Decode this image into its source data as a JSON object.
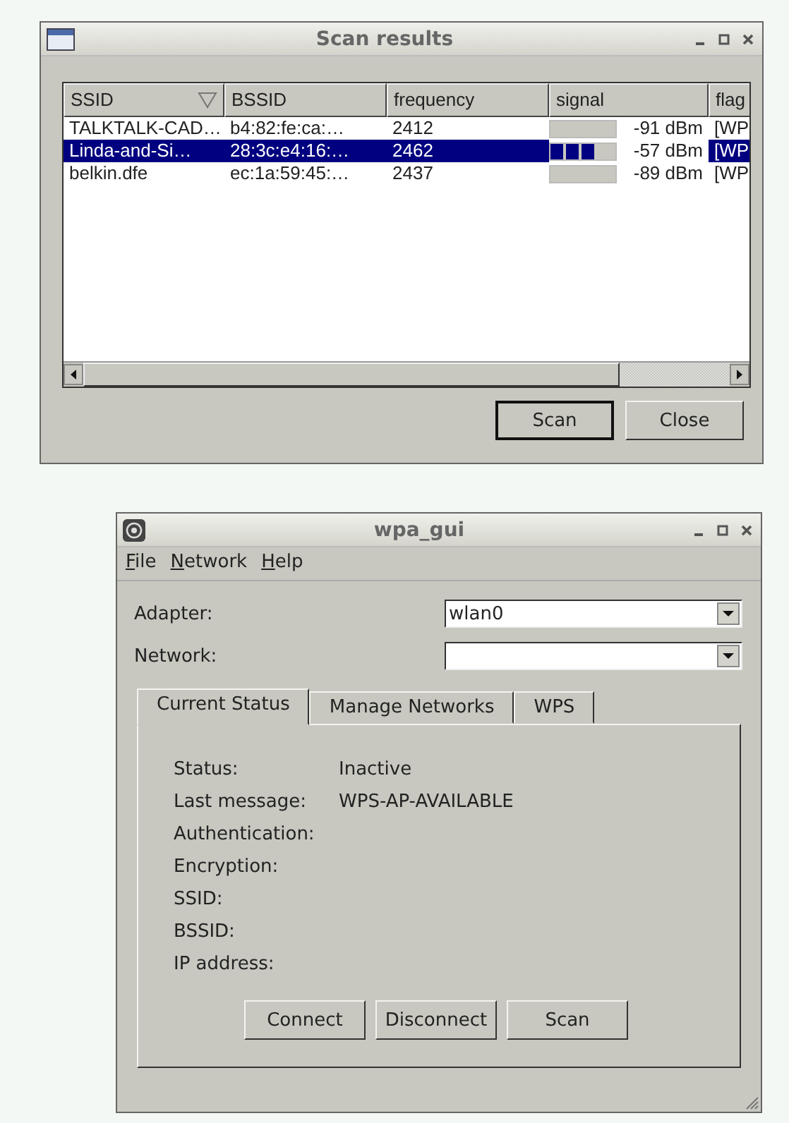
{
  "scan_results": {
    "title": "Scan results",
    "columns": [
      {
        "label": "SSID",
        "sorted": true
      },
      {
        "label": "BSSID",
        "sorted": false
      },
      {
        "label": "frequency",
        "sorted": false
      },
      {
        "label": "signal",
        "sorted": false
      },
      {
        "label": "flag",
        "sorted": false
      }
    ],
    "rows": [
      {
        "ssid": "TALKTALK-CAD…",
        "bssid": "b4:82:fe:ca:…",
        "frequency": "2412",
        "level": 0,
        "reading": "-91 dBm",
        "flags": "[WP",
        "selected": false
      },
      {
        "ssid": "Linda-and-Si…",
        "bssid": "28:3c:e4:16:…",
        "frequency": "2462",
        "level": 0.7,
        "reading": "-57 dBm",
        "flags": "[WP",
        "selected": true
      },
      {
        "ssid": "belkin.dfe",
        "bssid": "ec:1a:59:45:…",
        "frequency": "2437",
        "level": 0,
        "reading": "-89 dBm",
        "flags": "[WP",
        "selected": false
      }
    ],
    "buttons": [
      {
        "label": "Scan",
        "default": true
      },
      {
        "label": "Close",
        "default": false
      }
    ]
  },
  "wpa_gui": {
    "title": "wpa_gui",
    "menu": [
      "File",
      "Network",
      "Help"
    ],
    "fields": [
      {
        "label": "Adapter:",
        "value": "wlan0"
      },
      {
        "label": "Network:"
      }
    ],
    "tabs": [
      {
        "label": "Current Status",
        "selected": true
      },
      {
        "label": "Manage Networks",
        "selected": false
      },
      {
        "label": "WPS",
        "selected": false
      }
    ],
    "status": [
      {
        "label": "Status:",
        "value": "Inactive"
      },
      {
        "label": "Last message:",
        "value": "WPS-AP-AVAILABLE"
      },
      {
        "label": "Authentication:"
      },
      {
        "label": "Encryption:"
      },
      {
        "label": "SSID:"
      },
      {
        "label": "BSSID:"
      },
      {
        "label": "IP address:"
      }
    ],
    "buttons": [
      "Connect",
      "Disconnect",
      "Scan"
    ]
  }
}
